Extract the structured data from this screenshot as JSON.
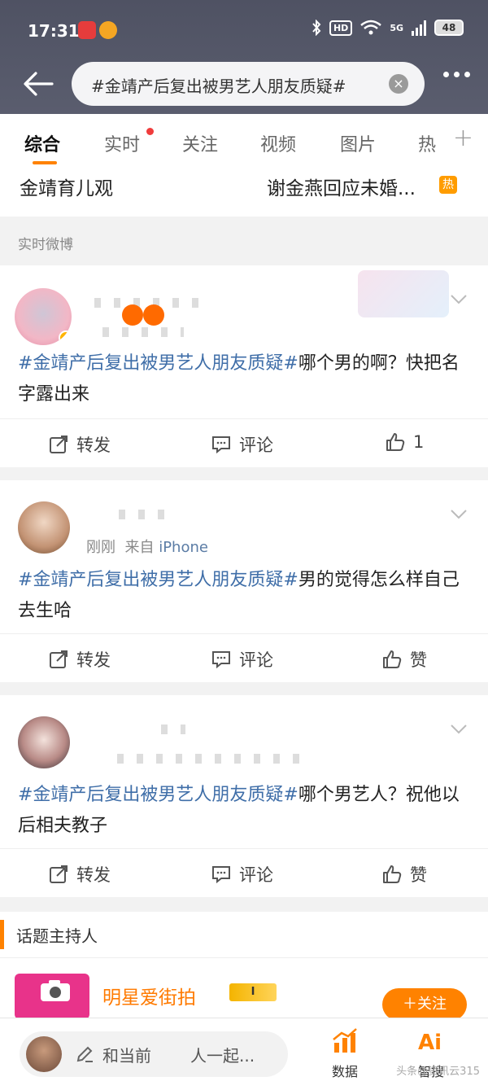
{
  "status": {
    "time": "17:31",
    "network": "5G",
    "hd": "HD",
    "battery": "48"
  },
  "header": {
    "search_query": "#金靖产后复出被男艺人朋友质疑#"
  },
  "tabs": [
    {
      "label": "综合"
    },
    {
      "label": "实时"
    },
    {
      "label": "关注"
    },
    {
      "label": "视频"
    },
    {
      "label": "图片"
    },
    {
      "label": "热"
    }
  ],
  "hot_topics": {
    "left": "金靖育儿观",
    "right": "谢金燕回应未婚...",
    "badge": "热"
  },
  "section_label": "实时微博",
  "posts": [
    {
      "tag": "#金靖产后复出被男艺人朋友质疑#",
      "text": "哪个男的啊？快把名字露出来",
      "repost": "转发",
      "comment": "评论",
      "like": "1"
    },
    {
      "time": "刚刚",
      "source_prefix": "来自",
      "source": "iPhone",
      "tag": "#金靖产后复出被男艺人朋友质疑#",
      "text": "男的觉得怎么样自己去生哈",
      "repost": "转发",
      "comment": "评论",
      "like": "赞"
    },
    {
      "tag": "#金靖产后复出被男艺人朋友质疑#",
      "text": "哪个男艺人？祝他以后相夫教子",
      "repost": "转发",
      "comment": "评论",
      "like": "赞"
    }
  ],
  "host": {
    "title": "话题主持人",
    "name": "明星爱街拍",
    "level": "I",
    "follow": "＋关注"
  },
  "bottom": {
    "comment_prefix": "和当前",
    "comment_suffix": "人一起...",
    "data_label": "数据",
    "ai_label": "智搜",
    "watermark": "头条@资讯云315"
  },
  "colors": {
    "accent": "#ff8200",
    "topic_link": "#3f6ea8"
  }
}
